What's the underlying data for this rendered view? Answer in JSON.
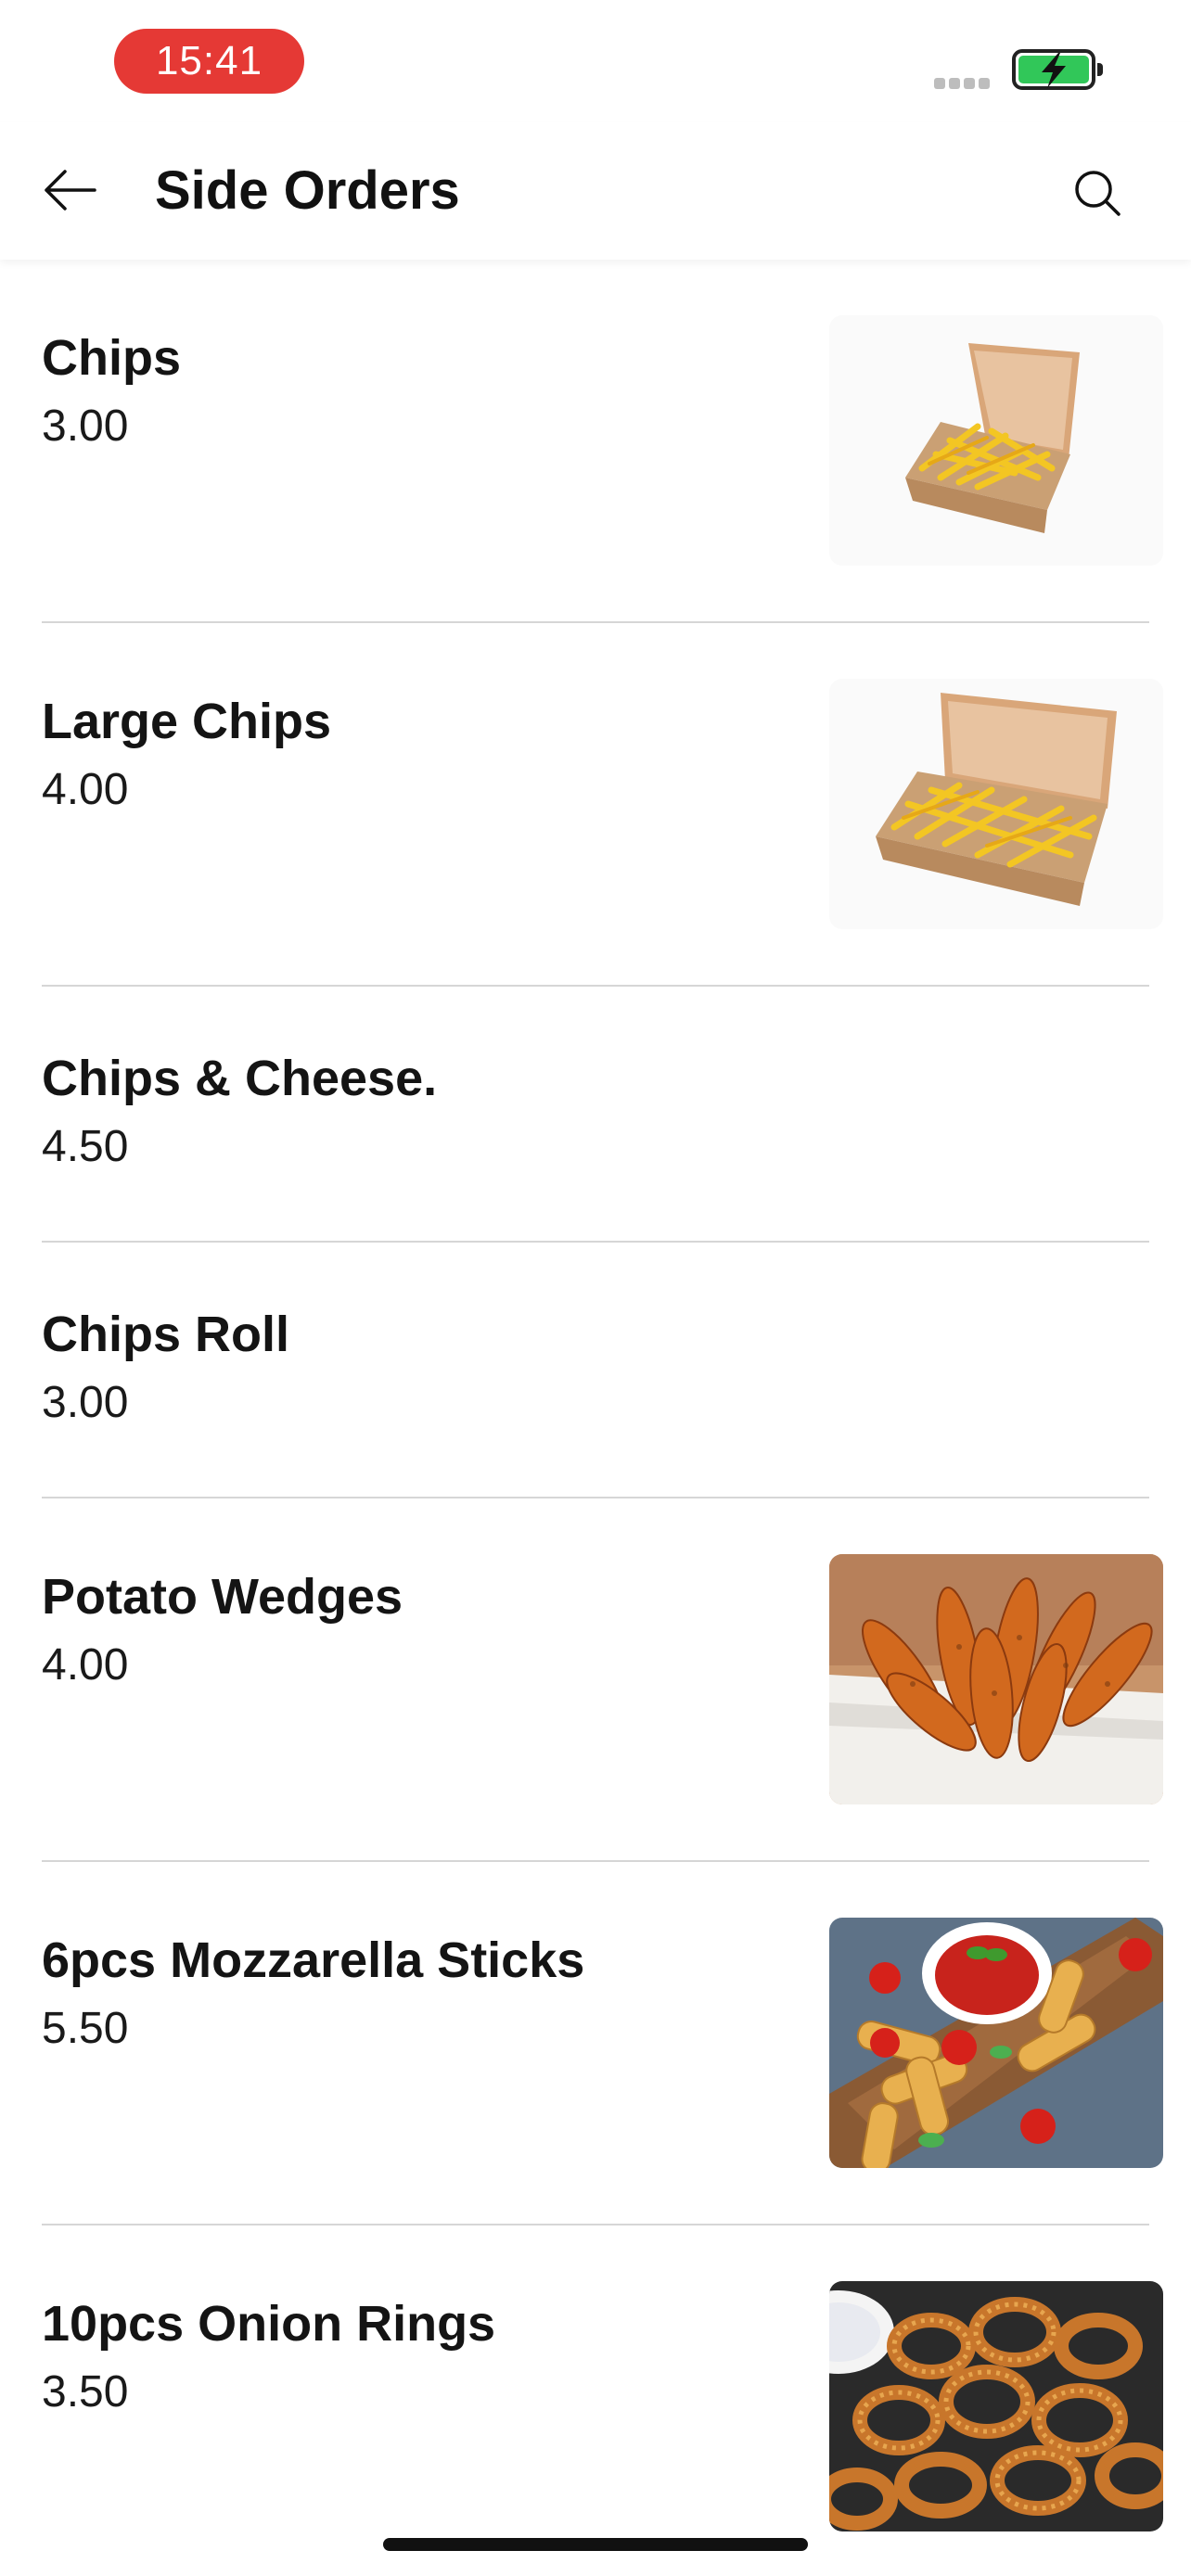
{
  "status": {
    "time": "15:41",
    "battery_color": "#31c759",
    "time_pill_color": "#e53935"
  },
  "header": {
    "title": "Side Orders",
    "back_icon": "arrow-left-icon",
    "search_icon": "search-icon"
  },
  "items": [
    {
      "name": "Chips",
      "price": "3.00",
      "image": "chips-box-image"
    },
    {
      "name": "Large Chips",
      "price": "4.00",
      "image": "large-chips-box-image"
    },
    {
      "name": "Chips & Cheese.",
      "price": "4.50",
      "image": null
    },
    {
      "name": "Chips Roll",
      "price": "3.00",
      "image": null
    },
    {
      "name": "Potato Wedges",
      "price": "4.00",
      "image": "potato-wedges-image"
    },
    {
      "name": "6pcs Mozzarella Sticks",
      "price": "5.50",
      "image": "mozzarella-sticks-image"
    },
    {
      "name": "10pcs Onion Rings",
      "price": "3.50",
      "image": "onion-rings-image"
    }
  ]
}
